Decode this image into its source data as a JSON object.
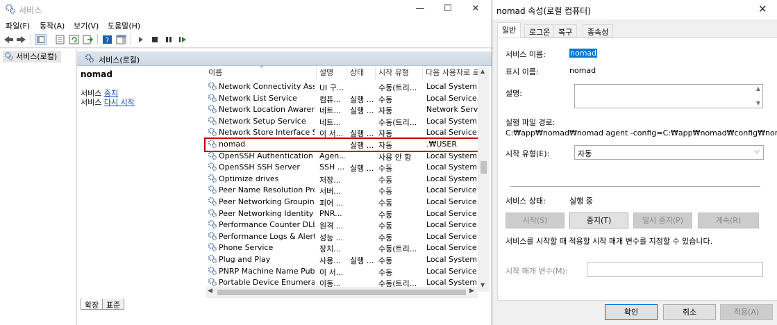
{
  "window": {
    "title": "서비스",
    "controls": {
      "minimize": "—",
      "maximize": "☐",
      "close": "✕"
    }
  },
  "menu": [
    "파일(F)",
    "동작(A)",
    "보기(V)",
    "도움말(H)"
  ],
  "tree": {
    "root_label": "서비스(로컬)"
  },
  "detail_header": {
    "title": "서비스(로컬)"
  },
  "selected_service": {
    "name": "nomad",
    "stop_prefix": "서비스 ",
    "stop_link": "중지",
    "restart_prefix": "서비스 ",
    "restart_link": "다시 시작"
  },
  "table": {
    "columns": [
      "이름",
      "설명",
      "상태",
      "시작 유형",
      "다음 사용자로 로"
    ],
    "rows": [
      {
        "name": "Network Connectivity Assis...",
        "desc": "UI 구...",
        "status": "",
        "start": "수동(트리...",
        "logon": "Local System"
      },
      {
        "name": "Network List Service",
        "desc": "컴퓨...",
        "status": "실행 ...",
        "start": "수동",
        "logon": "Local Service"
      },
      {
        "name": "Network Location Awareness",
        "desc": "네트...",
        "status": "실행 ...",
        "start": "자동",
        "logon": "Network Service"
      },
      {
        "name": "Network Setup Service",
        "desc": "네트...",
        "status": "",
        "start": "수동(트리...",
        "logon": "Local System"
      },
      {
        "name": "Network Store Interface Se...",
        "desc": "이 서...",
        "status": "실행 ...",
        "start": "자동",
        "logon": "Local Service"
      },
      {
        "name": "nomad",
        "desc": "",
        "status": "실행 ...",
        "start": "자동",
        "logon": ".₩USER"
      },
      {
        "name": "OpenSSH Authentication A...",
        "desc": "Agen...",
        "status": "",
        "start": "사용 안 함",
        "logon": "Local System"
      },
      {
        "name": "OpenSSH SSH Server",
        "desc": "SSH ...",
        "status": "실행 ...",
        "start": "수동",
        "logon": "Local System"
      },
      {
        "name": "Optimize drives",
        "desc": "저장...",
        "status": "",
        "start": "수동",
        "logon": "Local System"
      },
      {
        "name": "Peer Name Resolution Prot...",
        "desc": "서버...",
        "status": "",
        "start": "수동",
        "logon": "Local Service"
      },
      {
        "name": "Peer Networking Grouping",
        "desc": "피어 ...",
        "status": "",
        "start": "수동",
        "logon": "Local Service"
      },
      {
        "name": "Peer Networking Identity ...",
        "desc": "PNR...",
        "status": "",
        "start": "수동",
        "logon": "Local Service"
      },
      {
        "name": "Performance Counter DLL ...",
        "desc": "원격 ...",
        "status": "",
        "start": "수동",
        "logon": "Local Service"
      },
      {
        "name": "Performance Logs & Alerts",
        "desc": "성능 ...",
        "status": "",
        "start": "수동",
        "logon": "Local Service"
      },
      {
        "name": "Phone Service",
        "desc": "장치...",
        "status": "",
        "start": "수동(트리...",
        "logon": "Local Service"
      },
      {
        "name": "Plug and Play",
        "desc": "사용...",
        "status": "실행 ...",
        "start": "수동",
        "logon": "Local System"
      },
      {
        "name": "PNRP Machine Name Publi...",
        "desc": "이 서...",
        "status": "",
        "start": "수동",
        "logon": "Local Service"
      },
      {
        "name": "Portable Device Enumerato...",
        "desc": "이동...",
        "status": "",
        "start": "수동(트리...",
        "logon": "Local System"
      }
    ],
    "selected_index": 5
  },
  "bottom_tabs": [
    "확장",
    "표준"
  ],
  "dialog": {
    "title": "nomad 속성(로컬 컴퓨터)",
    "close": "✕",
    "tabs": [
      "일반",
      "로그온",
      "복구",
      "종속성"
    ],
    "service_name_label": "서비스 이름:",
    "service_name": "nomad",
    "display_name_label": "표시 이름:",
    "display_name": "nomad",
    "description_label": "설명:",
    "exe_path_label": "실행 파일 경로:",
    "exe_path": "C:₩app₩nomad₩nomad agent -config=C:₩app₩nomad₩config₩nomad_age",
    "startup_type_label": "시작 유형(E):",
    "startup_type": "자동",
    "service_status_label": "서비스 상태:",
    "service_status": "실행 중",
    "buttons": {
      "start": "시작(S)",
      "stop": "중지(T)",
      "pause": "일시 중지(P)",
      "resume": "계속(R)"
    },
    "hint": "서비스를 시작할 때 적용할 시작 매개 변수를 지정할 수 있습니다.",
    "param_label": "시작 매개 변수(M):",
    "footer": {
      "ok": "확인",
      "cancel": "취소",
      "apply": "적용(A)"
    }
  }
}
